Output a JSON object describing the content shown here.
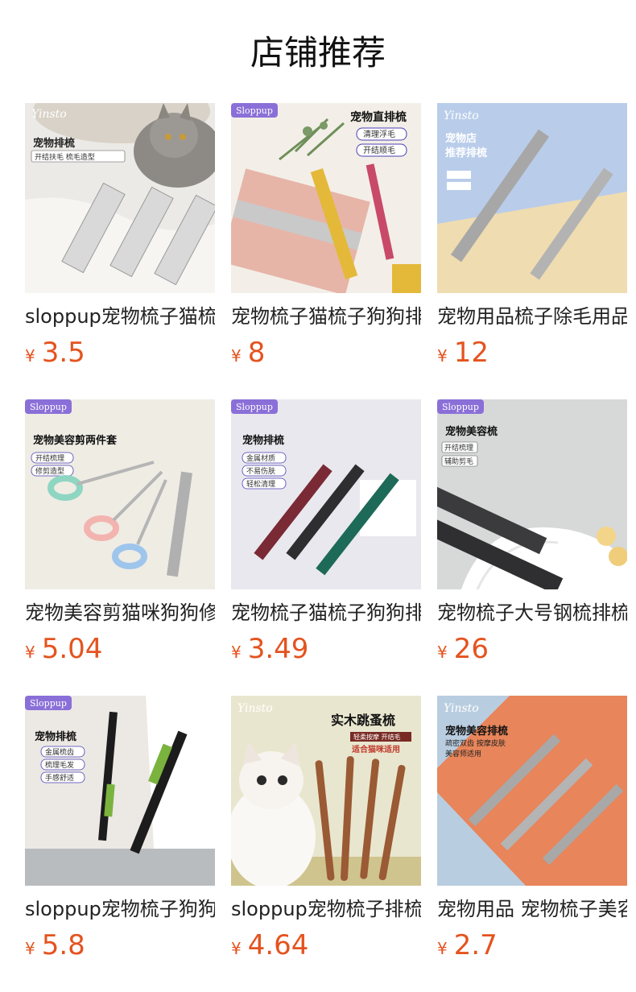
{
  "page": {
    "title": "店铺推荐"
  },
  "colors": {
    "price": "#e4531f",
    "text": "#222222"
  },
  "products": [
    {
      "name": "sloppup宠物梳子猫梳子",
      "currency": "¥",
      "price": "3.5",
      "image": {
        "brand": "Yinsto",
        "title": "宠物排梳",
        "subtitle": "开结扶毛  梳毛造型",
        "tags": [],
        "theme": "cat-bed"
      }
    },
    {
      "name": "宠物梳子猫梳子狗狗排梳",
      "currency": "¥",
      "price": "8",
      "image": {
        "brand": "Sloppup",
        "title": "宠物直排梳",
        "subtitle": "",
        "tags": [
          "清理浮毛",
          "开结顺毛"
        ],
        "theme": "colored-combs"
      }
    },
    {
      "name": "宠物用品梳子除毛用品",
      "currency": "¥",
      "price": "12",
      "image": {
        "brand": "Yinsto",
        "title": "宠物店",
        "subtitle": "推荐排梳",
        "tags": [],
        "theme": "blue-steel"
      }
    },
    {
      "name": "宠物美容剪猫咪狗狗修剪",
      "currency": "¥",
      "price": "5.04",
      "image": {
        "brand": "Sloppup",
        "title": "宠物美容剪两件套",
        "subtitle": "",
        "tags": [
          "开结梳理",
          "修剪造型"
        ],
        "theme": "scissors"
      }
    },
    {
      "name": "宠物梳子猫梳子狗狗排梳",
      "currency": "¥",
      "price": "3.49",
      "image": {
        "brand": "Sloppup",
        "title": "宠物排梳",
        "subtitle": "",
        "tags": [
          "金属材质",
          "不易伤肤",
          "轻松清理"
        ],
        "theme": "three-combs"
      }
    },
    {
      "name": "宠物梳子大号钢梳排梳",
      "currency": "¥",
      "price": "26",
      "image": {
        "brand": "Sloppup",
        "title": "宠物美容梳",
        "subtitle": "",
        "tags": [
          "开结梳理",
          "辅助剪毛"
        ],
        "theme": "black-combs"
      }
    },
    {
      "name": "sloppup宠物梳子狗狗排梳",
      "currency": "¥",
      "price": "5.8",
      "image": {
        "brand": "Sloppup",
        "title": "宠物排梳",
        "subtitle": "",
        "tags": [
          "金属梳齿",
          "梳理毛发",
          "手感舒适"
        ],
        "theme": "handle-combs"
      }
    },
    {
      "name": "sloppup宠物梳子排梳",
      "currency": "¥",
      "price": "4.64",
      "image": {
        "brand": "Yinsto",
        "title": "实木跳蚤梳",
        "subtitle": "适合猫咪适用",
        "tags": [
          "轻柔按摩 开结毛"
        ],
        "theme": "wood-combs"
      }
    },
    {
      "name": "宠物用品 宠物梳子美容排梳",
      "currency": "¥",
      "price": "2.7",
      "image": {
        "brand": "Yinsto",
        "title": "宠物美容排梳",
        "subtitle": "疏密双齿  按摩皮肤  美容师适用",
        "tags": [],
        "theme": "orange-blue"
      }
    }
  ]
}
